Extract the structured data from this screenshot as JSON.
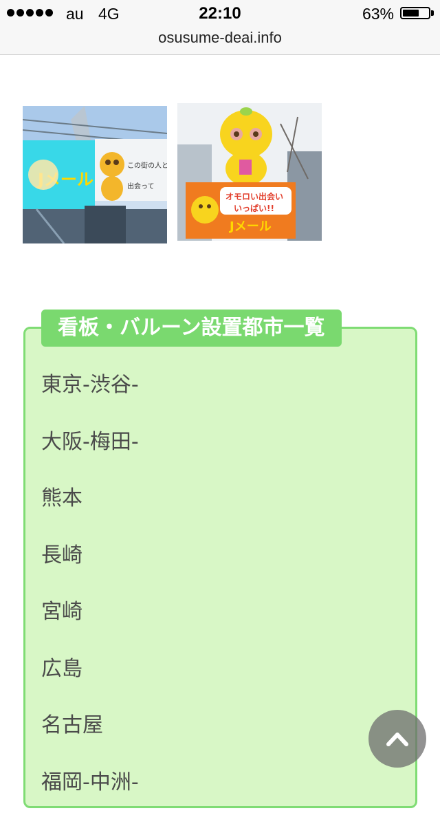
{
  "status_bar": {
    "carrier": "au",
    "network": "4G",
    "time": "22:10",
    "battery_percent": "63%",
    "battery_level": 0.63
  },
  "url_bar": {
    "domain": "osusume-deai.info"
  },
  "images": [
    {
      "description_icon": "billboard-photo"
    },
    {
      "description_icon": "balloon-photo"
    }
  ],
  "city_box": {
    "title": "看板・バルーン設置都市一覧",
    "cities": [
      "東京-渋谷-",
      "大阪-梅田-",
      "熊本",
      "長崎",
      "宮崎",
      "広島",
      "名古屋",
      "福岡-中洲-"
    ]
  },
  "colors": {
    "box_bg": "#d8f7c6",
    "box_border": "#7fdc74",
    "title_bg": "#7ad96f"
  }
}
